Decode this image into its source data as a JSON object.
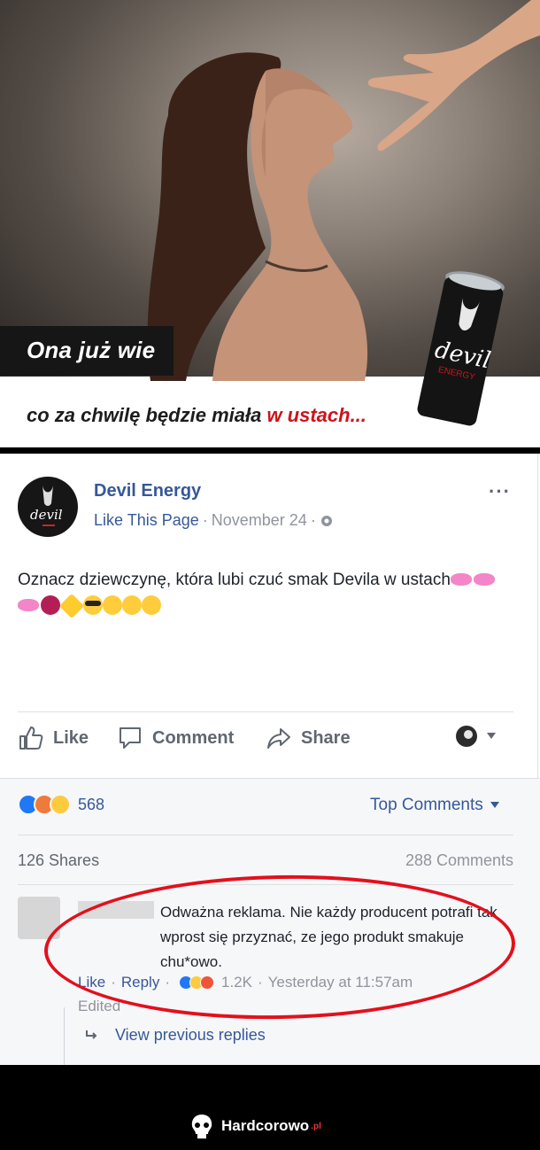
{
  "ad": {
    "headline": "Ona już wie",
    "subline": "co za chwilę będzie miała ",
    "subline_red": "w ustach...",
    "can_brand": "devil",
    "can_sub": "ENERGY"
  },
  "post": {
    "page_name": "Devil Energy",
    "like_link": "Like This Page",
    "sep1": "·",
    "date": "November 24",
    "sep2": "·",
    "more": "···",
    "text": "Oznacz dziewczynę, która lubi czuć smak Devila w ustach",
    "emoji": [
      "kiss",
      "kiss",
      "kiss",
      "devil",
      "sun",
      "cool",
      "tongue",
      "smile",
      "smile"
    ]
  },
  "actions": {
    "like": "Like",
    "comment": "Comment",
    "share": "Share"
  },
  "stats": {
    "reaction_count": "568",
    "reactions": [
      "like",
      "angry",
      "haha"
    ],
    "top_comments": "Top Comments",
    "shares": "126 Shares",
    "comments": "288 Comments"
  },
  "comment": {
    "text": "Odważna reklama. Nie każdy producent potrafi tak wprost się przyznać, ze jego produkt smakuje chu*owo.",
    "like": "Like",
    "reply": "Reply",
    "dot": "·",
    "reaction_count": "1.2K",
    "time": "Yesterday at 11:57am",
    "edited": "Edited",
    "view_replies": "View previous replies"
  },
  "footer": {
    "brand": "Hardcorowo",
    "tld": ".pl"
  },
  "colors": {
    "facebook_link": "#365899",
    "highlight_red": "#e3101c",
    "ad_red": "#d0121a"
  }
}
